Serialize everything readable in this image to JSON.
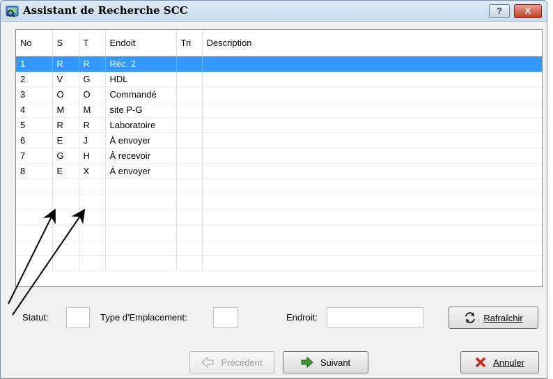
{
  "window": {
    "title": "Assistant de Recherche SCC",
    "help_label": "?",
    "close_label": "X"
  },
  "grid": {
    "columns": [
      "No",
      "S",
      "T",
      "Endoit",
      "Tri",
      "Description"
    ],
    "rows": [
      {
        "no": "1",
        "s": "R",
        "t": "R",
        "endoit": "Réc. 2",
        "tri": "",
        "description": "",
        "selected": true
      },
      {
        "no": "2",
        "s": "V",
        "t": "G",
        "endoit": "HDL",
        "tri": "",
        "description": ""
      },
      {
        "no": "3",
        "s": "O",
        "t": "O",
        "endoit": "Commandé",
        "tri": "",
        "description": ""
      },
      {
        "no": "4",
        "s": "M",
        "t": "M",
        "endoit": "site P-G",
        "tri": "",
        "description": ""
      },
      {
        "no": "5",
        "s": "R",
        "t": "R",
        "endoit": "Laboratoire",
        "tri": "",
        "description": ""
      },
      {
        "no": "6",
        "s": "E",
        "t": "J",
        "endoit": "À envoyer",
        "tri": "",
        "description": ""
      },
      {
        "no": "7",
        "s": "G",
        "t": "H",
        "endoit": "À recevoir",
        "tri": "",
        "description": ""
      },
      {
        "no": "8",
        "s": "E",
        "t": "X",
        "endoit": "À envoyer",
        "tri": "",
        "description": ""
      }
    ],
    "selection_color": "#3399ff"
  },
  "filters": {
    "statut_label": "Statut:",
    "statut_value": "",
    "type_label": "Type d'Emplacement:",
    "type_value": "",
    "endroit_label": "Endroit:",
    "endroit_value": ""
  },
  "buttons": {
    "refresh": "Rafraîchir",
    "previous": "Précédent",
    "next": "Suivant",
    "cancel": "Annuler"
  },
  "icons": {
    "refresh": "refresh-icon",
    "previous": "arrow-left-icon",
    "next": "arrow-right-icon",
    "cancel": "cross-icon"
  }
}
